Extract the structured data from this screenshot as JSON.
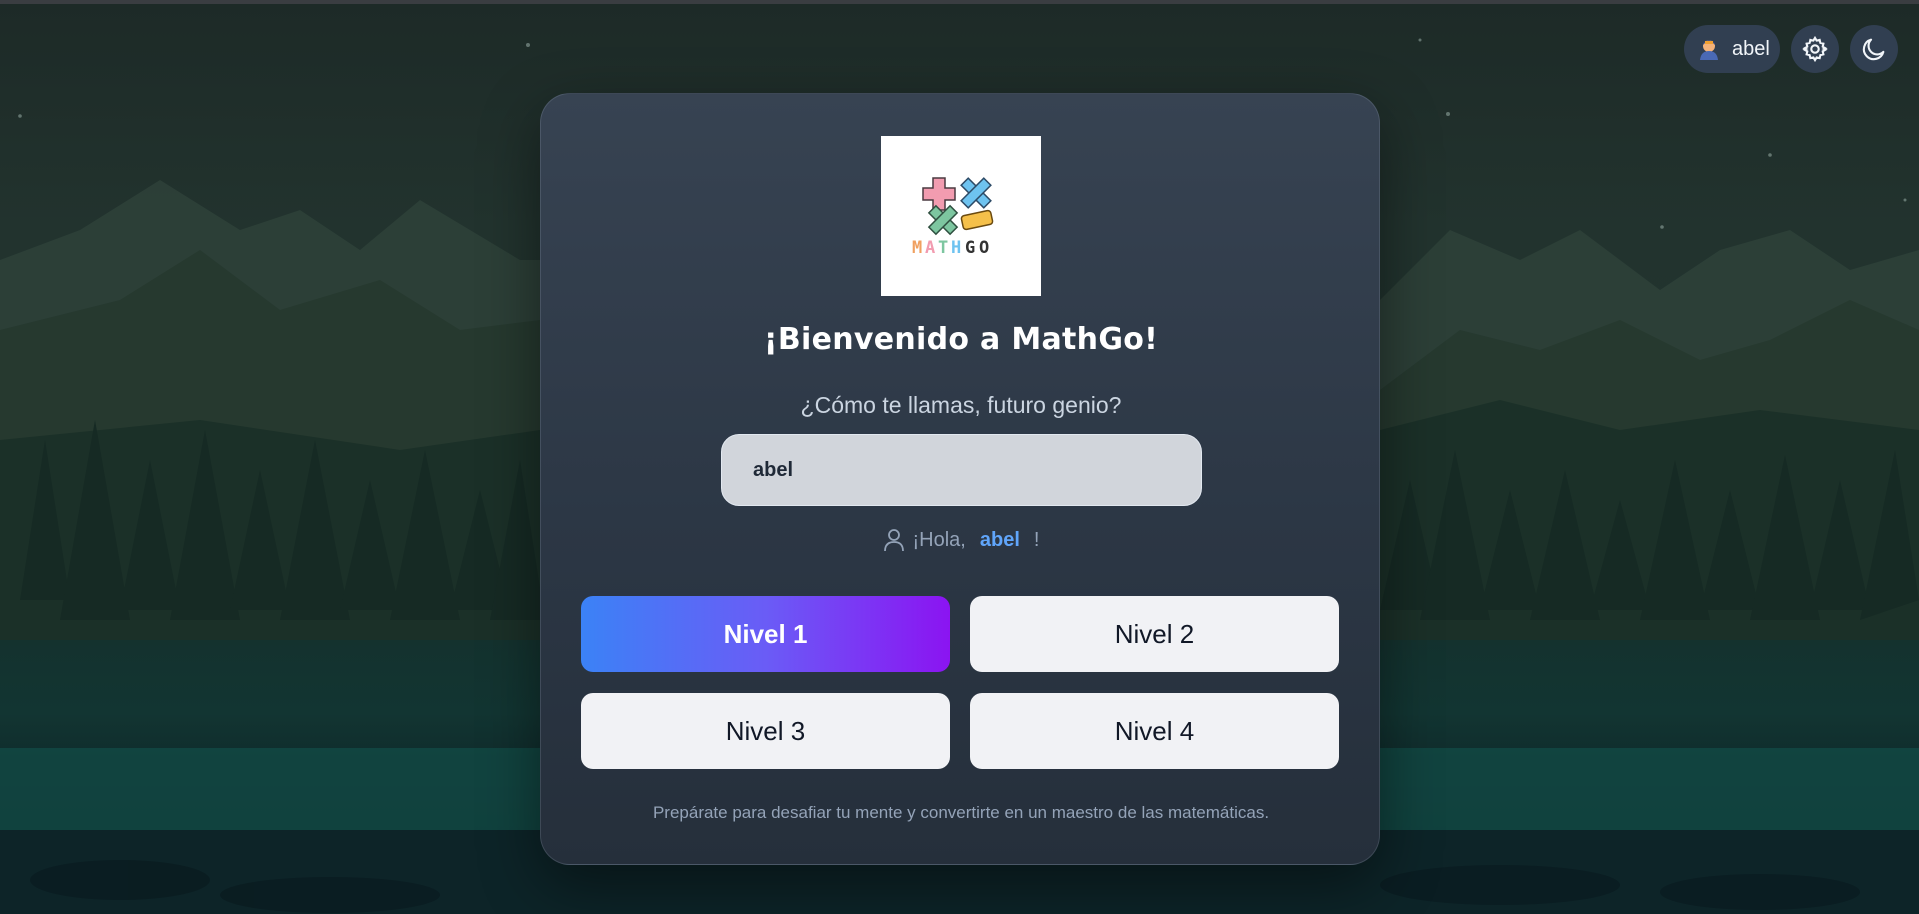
{
  "header": {
    "username": "abel",
    "settings_icon": "gear-icon",
    "theme_icon": "moon-icon",
    "avatar_icon": "user-avatar"
  },
  "brand": {
    "logo_text_math": "MATH",
    "logo_text_go": "GO"
  },
  "welcome": {
    "title": "¡Bienvenido a MathGo!",
    "question": "¿Cómo te llamas, futuro genio?",
    "name_value": "abel",
    "greeting_prefix": "¡Hola,",
    "greeting_name": "abel",
    "greeting_suffix": "!"
  },
  "levels": [
    {
      "label": "Nivel 1",
      "selected": true
    },
    {
      "label": "Nivel 2",
      "selected": false
    },
    {
      "label": "Nivel 3",
      "selected": false
    },
    {
      "label": "Nivel 4",
      "selected": false
    }
  ],
  "footer": {
    "text": "Prepárate para desafiar tu mente y convertirte en un maestro de las matemáticas."
  },
  "colors": {
    "accent_start": "#3b82f6",
    "accent_end": "#8b14f2",
    "name_highlight": "#60a5fa",
    "card_bg": "#323d4b"
  }
}
